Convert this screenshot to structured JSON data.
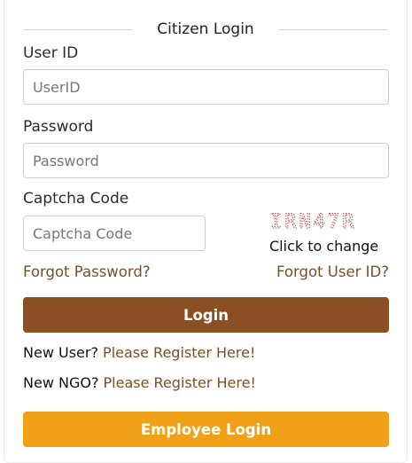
{
  "login": {
    "title": "Citizen Login",
    "user_id_label": "User ID",
    "user_id_placeholder": "UserID",
    "password_label": "Password",
    "password_placeholder": "Password",
    "captcha_label": "Captcha Code",
    "captcha_placeholder": "Captcha Code",
    "captcha_value": "IRN47R",
    "captcha_color": "#c23a3a",
    "click_to_change": "Click to change",
    "forgot_password": "Forgot Password?",
    "forgot_user_id": "Forgot User ID?",
    "login_button": "Login",
    "login_button_color": "#8a4f22",
    "new_user_prefix": "New User?",
    "new_user_link": "Please Register Here!",
    "new_ngo_prefix": "New NGO?",
    "new_ngo_link": "Please Register Here!",
    "employee_login_button": "Employee Login",
    "employee_button_color": "#f0a117",
    "link_color": "#7b4f24"
  }
}
